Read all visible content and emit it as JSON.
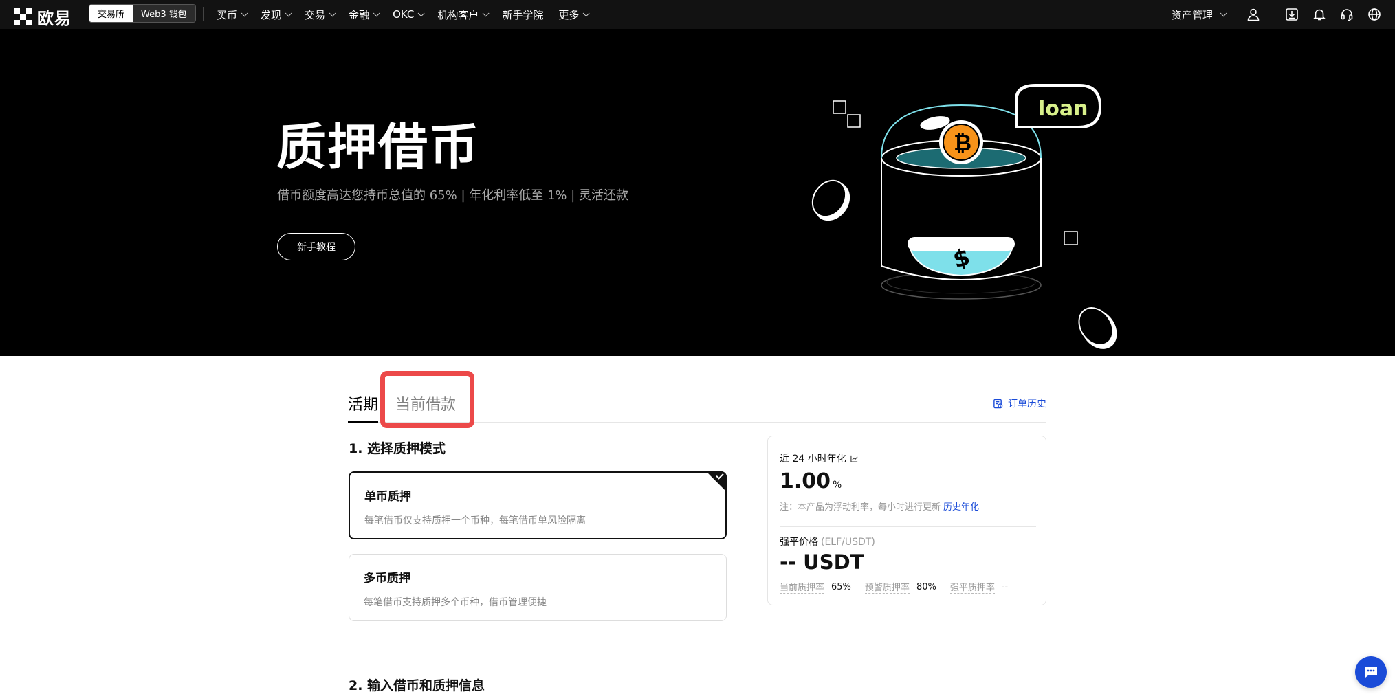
{
  "brand": {
    "name": "欧易"
  },
  "mode_switch": {
    "exchange": "交易所",
    "web3": "Web3 钱包"
  },
  "nav": {
    "items": [
      {
        "label": "买币",
        "has_dropdown": true
      },
      {
        "label": "发现",
        "has_dropdown": true
      },
      {
        "label": "交易",
        "has_dropdown": true
      },
      {
        "label": "金融",
        "has_dropdown": true
      },
      {
        "label": "OKC",
        "has_dropdown": true
      },
      {
        "label": "机构客户",
        "has_dropdown": true
      },
      {
        "label": "新手学院",
        "has_dropdown": false
      },
      {
        "label": "更多",
        "has_dropdown": true
      }
    ],
    "asset_management": "资产管理",
    "icons": [
      "user-icon",
      "download-icon",
      "bell-icon",
      "headset-icon",
      "globe-icon"
    ]
  },
  "hero": {
    "title": "质押借币",
    "subtitle": "借币额度高达您持币总值的 65% | 年化利率低至 1% | 灵活还款",
    "tutorial_button": "新手教程",
    "illustration_text": "loan"
  },
  "tabs": {
    "active": "活期",
    "current_loans": "当前借款",
    "order_history": "订单历史"
  },
  "section1": {
    "title": "1. 选择质押模式",
    "modes": [
      {
        "title": "单币质押",
        "desc": "每笔借币仅支持质押一个币种，每笔借币单风险隔离",
        "selected": true
      },
      {
        "title": "多币质押",
        "desc": "每笔借币支持质押多个币种，借币管理便捷",
        "selected": false
      }
    ]
  },
  "rate_panel": {
    "rate_label": "近 24 小时年化",
    "rate_value": "1.00",
    "rate_unit": "%",
    "note": "注：本产品为浮动利率，每小时进行更新",
    "history_link": "历史年化",
    "liq_label": "强平价格",
    "liq_pair": "(ELF/USDT)",
    "liq_value": "-- USDT",
    "ratios": [
      {
        "label": "当前质押率",
        "value": "65%"
      },
      {
        "label": "预警质押率",
        "value": "80%"
      },
      {
        "label": "强平质押率",
        "value": "--"
      }
    ]
  },
  "section2": {
    "title": "2. 输入借币和质押信息"
  },
  "colors": {
    "accent_blue": "#1a4bd8",
    "highlight_red": "#ec4949",
    "loan_green": "#d8f08a",
    "dome_cyan": "#7ee0ea",
    "btc_orange": "#f7931a"
  }
}
